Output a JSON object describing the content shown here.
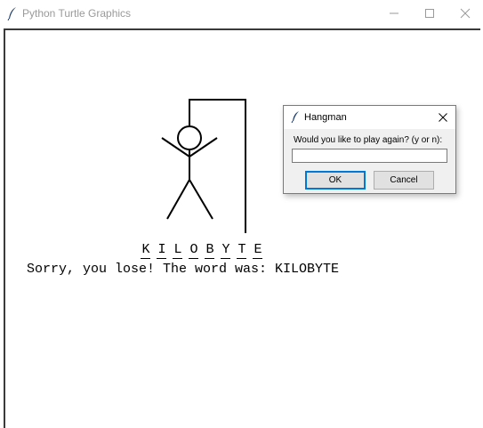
{
  "window": {
    "title": "Python Turtle Graphics",
    "title_icon": "feather-icon",
    "controls": [
      "minimize-icon",
      "maximize-icon",
      "close-icon"
    ]
  },
  "game": {
    "word_letters": [
      "K",
      "I",
      "L",
      "O",
      "B",
      "Y",
      "T",
      "E"
    ],
    "message": "Sorry, you lose! The word was: KILOBYTE"
  },
  "dialog": {
    "title": "Hangman",
    "icon": "feather-icon",
    "prompt": "Would you like to play again? (y or n):",
    "input_value": "",
    "ok_label": "OK",
    "cancel_label": "Cancel"
  },
  "colors": {
    "dialog_accent": "#0078d7",
    "dialog_bg": "#f0f0f0"
  }
}
